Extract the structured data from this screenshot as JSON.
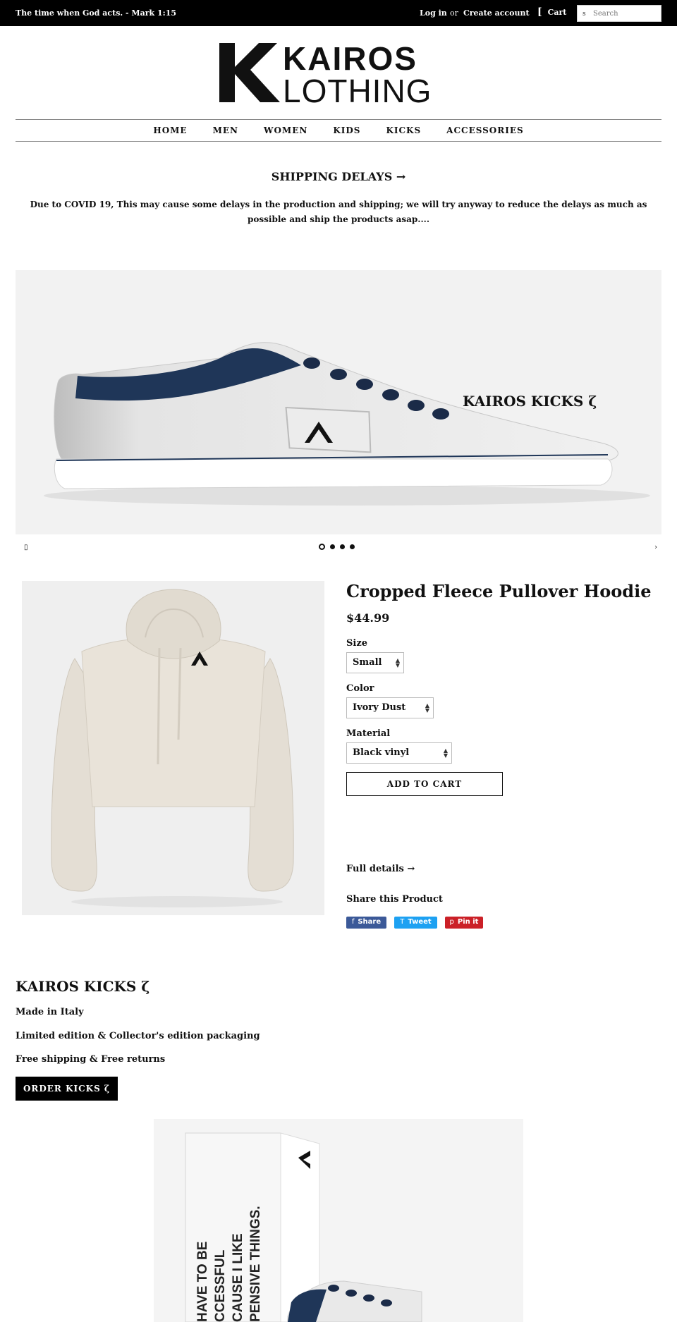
{
  "topbar": {
    "announcement": "The time when God acts. - Mark 1:15",
    "login": "Log in",
    "or": "or",
    "create_account": "Create account",
    "cart_icon": "[",
    "cart": "Cart",
    "search_icon": "s",
    "search_placeholder": "Search"
  },
  "logo": {
    "line1": "KAIROS",
    "line2": "LOTHING"
  },
  "nav": {
    "items": [
      {
        "label": "HOME"
      },
      {
        "label": "MEN"
      },
      {
        "label": "WOMEN"
      },
      {
        "label": "KIDS"
      },
      {
        "label": "KICKS"
      },
      {
        "label": "ACCESSORIES"
      }
    ]
  },
  "notice": {
    "title": "SHIPPING DELAYS →",
    "text": "Due to COVID 19, This may cause some delays in the production and shipping; we will try anyway to reduce the delays as much as possible and ship the products asap...."
  },
  "hero": {
    "caption": "KAIROS KICKS ζ",
    "prev_icon": "▯",
    "next_icon": "›",
    "slide_count": 4,
    "active_slide": 1
  },
  "product": {
    "title": "Cropped Fleece Pullover Hoodie",
    "price": "$44.99",
    "size_label": "Size",
    "size_value": "Small",
    "color_label": "Color",
    "color_value": "Ivory Dust",
    "material_label": "Material",
    "material_value": "Black vinyl",
    "add_to_cart": "ADD TO CART",
    "full_details": "Full details →",
    "share_title": "Share this Product",
    "share": {
      "facebook_icon": "f",
      "facebook": "Share",
      "twitter_icon": "T",
      "twitter": "Tweet",
      "pinterest_icon": "p",
      "pinterest": "Pin it"
    },
    "colors": {
      "facebook": "#3b5998",
      "twitter": "#1da1f2",
      "pinterest": "#cb2027"
    }
  },
  "promo": {
    "title": "KAIROS KICKS ζ",
    "line1": "Made in Italy",
    "line2": "Limited edition & Collector's edition packaging",
    "line3": "Free shipping & Free returns",
    "button": "ORDER KICKS ζ",
    "box_text": [
      "HAVE TO BE",
      "CCESSFUL",
      "CAUSE I LIKE",
      "PENSIVE THINGS."
    ]
  }
}
